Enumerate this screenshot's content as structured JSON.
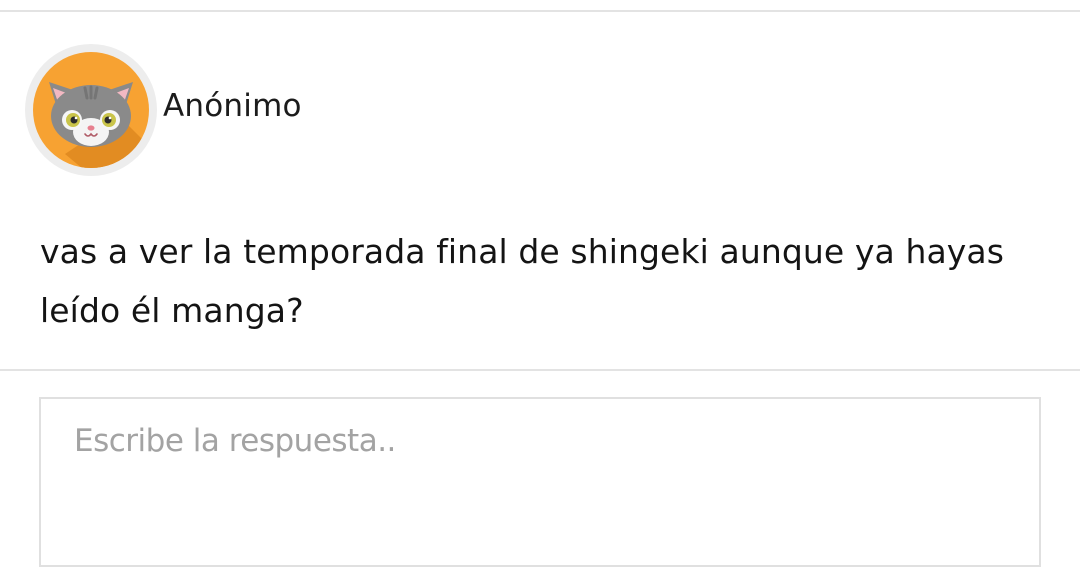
{
  "question": {
    "author": {
      "name": "Anónimo",
      "avatar_icon": "cat-avatar-icon",
      "avatar_bg": "#f7a232",
      "avatar_shadow": "#e28c22"
    },
    "text": "vas a ver la temporada final de shingeki aunque ya hayas leído él manga?"
  },
  "answer": {
    "placeholder": "Escribe la respuesta..",
    "value": ""
  },
  "colors": {
    "divider": "#e3e3e3",
    "input_border": "#e0e0e0",
    "placeholder": "#a3a3a3"
  }
}
